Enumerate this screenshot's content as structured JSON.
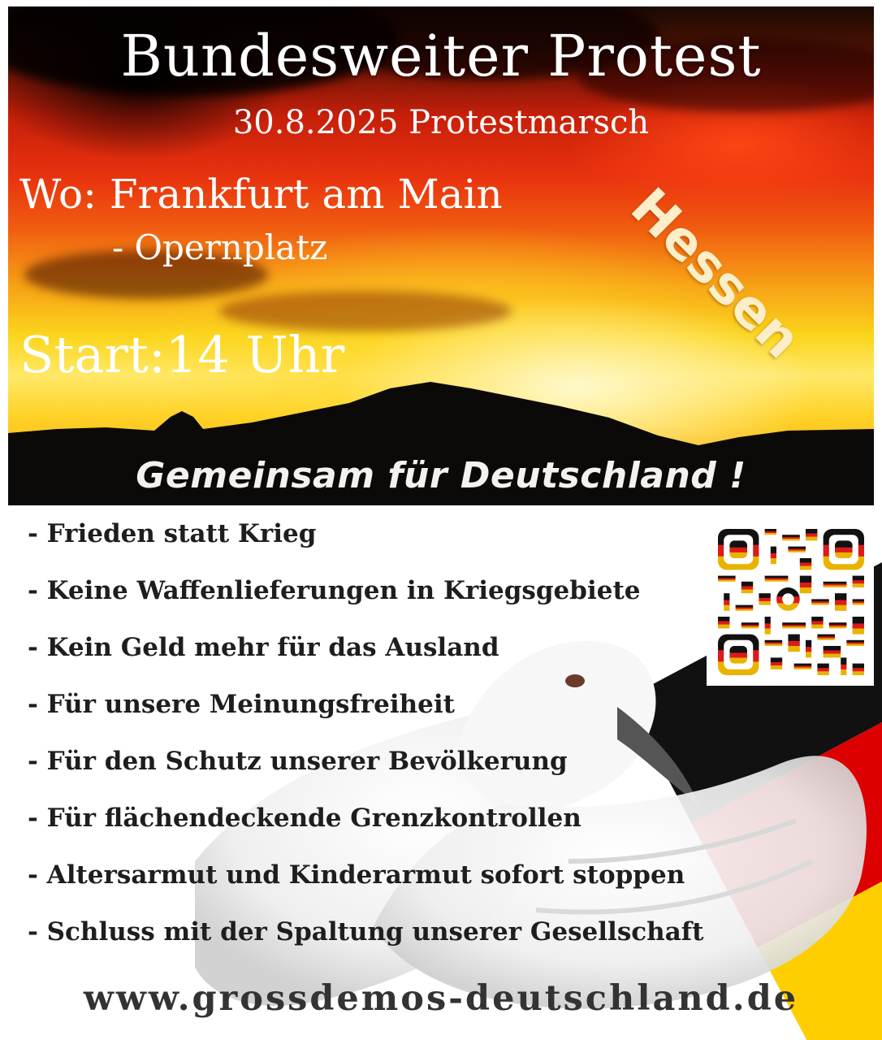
{
  "poster": {
    "title": "Bundesweiter Protest",
    "subtitle": "30.8.2025 Protestmarsch",
    "location_line": "Wo: Frankfurt am Main",
    "location_detail": "- Opernplatz",
    "start": "Start:14 Uhr",
    "region": "Hessen",
    "slogan": "Gemeinsam für Deutschland !",
    "demands": [
      "- Frieden statt Krieg",
      "- Keine Waffenlieferungen in Kriegsgebiete",
      "- Kein Geld mehr für das Ausland",
      "- Für unsere Meinungsfreiheit",
      "- Für den Schutz unserer Bevölkerung",
      "- Für flächendeckende Grenzkontrollen",
      "- Altersarmut und  Kinderarmut sofort stoppen",
      "- Schluss mit der Spaltung unserer Gesellschaft"
    ],
    "website": "www.grossdemos-deutschland.de"
  },
  "colors": {
    "flag_black": "#111111",
    "flag_red": "#dd0000",
    "flag_gold": "#ffce00",
    "text_white": "#ffffff",
    "text_dark": "#1e1e1e"
  },
  "icons": [
    "qr-code-icon",
    "dove-illustration",
    "german-flag-graphic"
  ]
}
